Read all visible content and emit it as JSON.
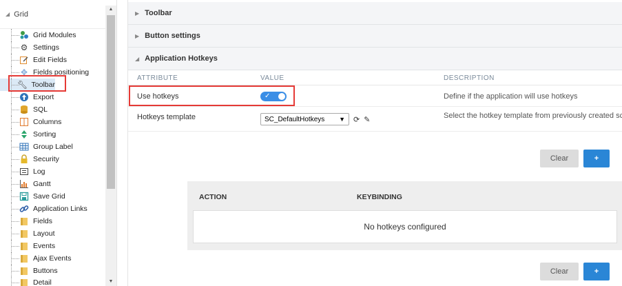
{
  "tree": {
    "root_label": "Grid",
    "items": [
      {
        "label": "Grid Modules",
        "icon": "modules-icon"
      },
      {
        "label": "Settings",
        "icon": "gear-icon"
      },
      {
        "label": "Edit Fields",
        "icon": "edit-fields-icon"
      },
      {
        "label": "Fields positioning",
        "icon": "positioning-icon"
      },
      {
        "label": "Toolbar",
        "icon": "wrench-icon"
      },
      {
        "label": "Export",
        "icon": "export-icon"
      },
      {
        "label": "SQL",
        "icon": "database-icon"
      },
      {
        "label": "Columns",
        "icon": "columns-icon"
      },
      {
        "label": "Sorting",
        "icon": "sorting-icon"
      },
      {
        "label": "Group Label",
        "icon": "table-icon"
      },
      {
        "label": "Security",
        "icon": "lock-icon"
      },
      {
        "label": "Log",
        "icon": "log-icon"
      },
      {
        "label": "Gantt",
        "icon": "gantt-icon"
      },
      {
        "label": "Save Grid",
        "icon": "save-icon"
      },
      {
        "label": "Application Links",
        "icon": "link-icon"
      },
      {
        "label": "Fields",
        "icon": "folder-icon"
      },
      {
        "label": "Layout",
        "icon": "folder-icon"
      },
      {
        "label": "Events",
        "icon": "folder-icon"
      },
      {
        "label": "Ajax Events",
        "icon": "folder-icon"
      },
      {
        "label": "Buttons",
        "icon": "folder-icon"
      },
      {
        "label": "Detail",
        "icon": "folder-icon"
      }
    ]
  },
  "sections": {
    "toolbar": "Toolbar",
    "button_settings": "Button settings",
    "app_hotkeys": "Application Hotkeys"
  },
  "attr_table": {
    "headers": {
      "attribute": "ATTRIBUTE",
      "value": "VALUE",
      "description": "DESCRIPTION"
    },
    "rows": [
      {
        "attribute": "Use hotkeys",
        "toggle_on": true,
        "description": "Define if the application will use hotkeys"
      },
      {
        "attribute": "Hotkeys template",
        "select_value": "SC_DefaultHotkeys",
        "description": "Select the hotkey template from previously created sch"
      }
    ]
  },
  "buttons": {
    "clear": "Clear",
    "add": "+"
  },
  "hotkeys_table": {
    "headers": {
      "action": "ACTION",
      "keybinding": "KEYBINDING"
    },
    "empty_text": "No hotkeys configured"
  },
  "colors": {
    "accent": "#2a86d6",
    "highlight": "#e53935",
    "toggle": "#3a8ee6"
  }
}
